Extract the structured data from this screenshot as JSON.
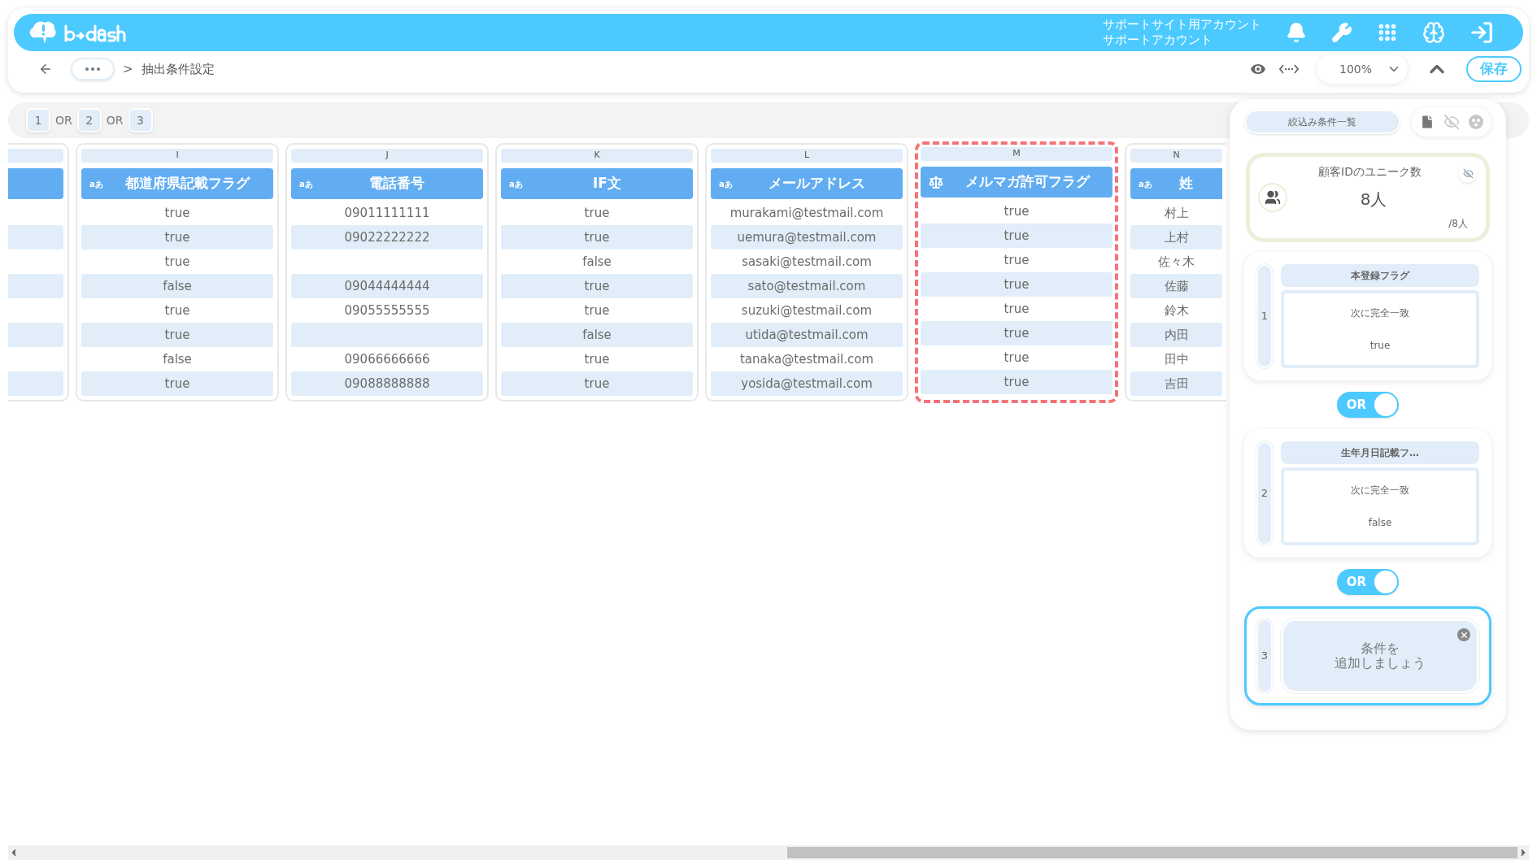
{
  "header": {
    "account_lines": [
      "サポートサイト用アカウント",
      "サポートアカウント"
    ]
  },
  "breadcrumb": {
    "separator": ">",
    "current": "抽出条件設定"
  },
  "toolbar": {
    "zoom": "100%",
    "save_button": "保存"
  },
  "groups": [
    {
      "kind": "chip",
      "label": "1"
    },
    {
      "kind": "operator",
      "label": "OR"
    },
    {
      "kind": "chip",
      "label": "2"
    },
    {
      "kind": "operator",
      "label": "OR"
    },
    {
      "kind": "chip",
      "label": "3"
    }
  ],
  "columns": [
    {
      "letter": "I",
      "kind": "text",
      "type_label": "aあ",
      "title": "都道府県記載フラグ",
      "highlighted": false,
      "cells": [
        "true",
        "true",
        "true",
        "false",
        "true",
        "true",
        "false",
        "true"
      ]
    },
    {
      "letter": "J",
      "kind": "text",
      "type_label": "aあ",
      "title": "電話番号",
      "highlighted": false,
      "cells": [
        "09011111111",
        "09022222222",
        null,
        "09044444444",
        "09055555555",
        null,
        "09066666666",
        "09088888888"
      ]
    },
    {
      "letter": "K",
      "kind": "text",
      "type_label": "aあ",
      "title": "IF文",
      "highlighted": false,
      "cells": [
        "true",
        "true",
        "false",
        "true",
        "true",
        "false",
        "true",
        "true"
      ]
    },
    {
      "letter": "L",
      "kind": "text",
      "type_label": "aあ",
      "title": "メールアドレス",
      "highlighted": false,
      "cells": [
        "murakami@testmail.com",
        "uemura@testmail.com",
        "sasaki@testmail.com",
        "sato@testmail.com",
        "suzuki@testmail.com",
        "utida@testmail.com",
        "tanaka@testmail.com",
        "yosida@testmail.com"
      ]
    },
    {
      "letter": "M",
      "kind": "boolean",
      "title": "メルマガ許可フラグ",
      "highlighted": true,
      "cells": [
        "true",
        "true",
        "true",
        "true",
        "true",
        "true",
        "true",
        "true"
      ]
    },
    {
      "letter": "N",
      "kind": "text",
      "type_label": "aあ",
      "title": "姓",
      "highlighted": false,
      "cells": [
        "村上",
        "上村",
        "佐々木",
        "佐藤",
        "鈴木",
        "内田",
        "田中",
        "吉田"
      ]
    }
  ],
  "panel": {
    "title": "絞込み条件一覧",
    "summary": {
      "label": "顧客IDのユニーク数",
      "count": "8人",
      "total": "/8人"
    },
    "conditions": [
      {
        "kind": "condition",
        "number": "1",
        "field": "本登録フラグ",
        "operator": "次に完全一致",
        "value": "true",
        "selected": false
      },
      {
        "kind": "condition",
        "number": "2",
        "field": "生年月日記載フ…",
        "operator": "次に完全一致",
        "value": "false",
        "selected": false
      },
      {
        "kind": "placeholder",
        "number": "3",
        "text_lines": [
          "条件を",
          "追加しましょう"
        ],
        "selected": true
      }
    ],
    "connectors": [
      {
        "label": "OR",
        "on": true
      },
      {
        "label": "OR",
        "on": true
      }
    ]
  }
}
